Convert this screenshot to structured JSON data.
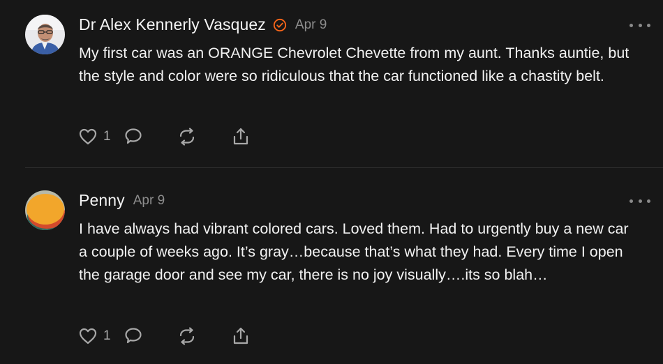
{
  "posts": [
    {
      "author": "Dr Alex Kennerly Vasquez",
      "verified": true,
      "date": "Apr 9",
      "text": "My first car was an ORANGE Chevrolet Chevette from my aunt. Thanks auntie, but the style and color were so ridiculous that the car functioned like a chastity belt.",
      "likes": "1",
      "icons": [
        "heart-icon",
        "comment-icon",
        "restack-icon",
        "share-icon",
        "more-icon"
      ]
    },
    {
      "author": "Penny",
      "verified": false,
      "date": "Apr 9",
      "text": "I have always had vibrant colored cars. Loved them. Had to urgently buy a new car a couple of weeks ago. It’s gray…because that’s what they had. Every time I open the garage door and see my car, there is no joy visually….its so blah…",
      "likes": "1",
      "icons": [
        "heart-icon",
        "comment-icon",
        "restack-icon",
        "share-icon",
        "more-icon"
      ]
    }
  ],
  "colors": {
    "background": "#171717",
    "verified_badge": "#ff6719",
    "muted_text": "#8d8d8d"
  }
}
